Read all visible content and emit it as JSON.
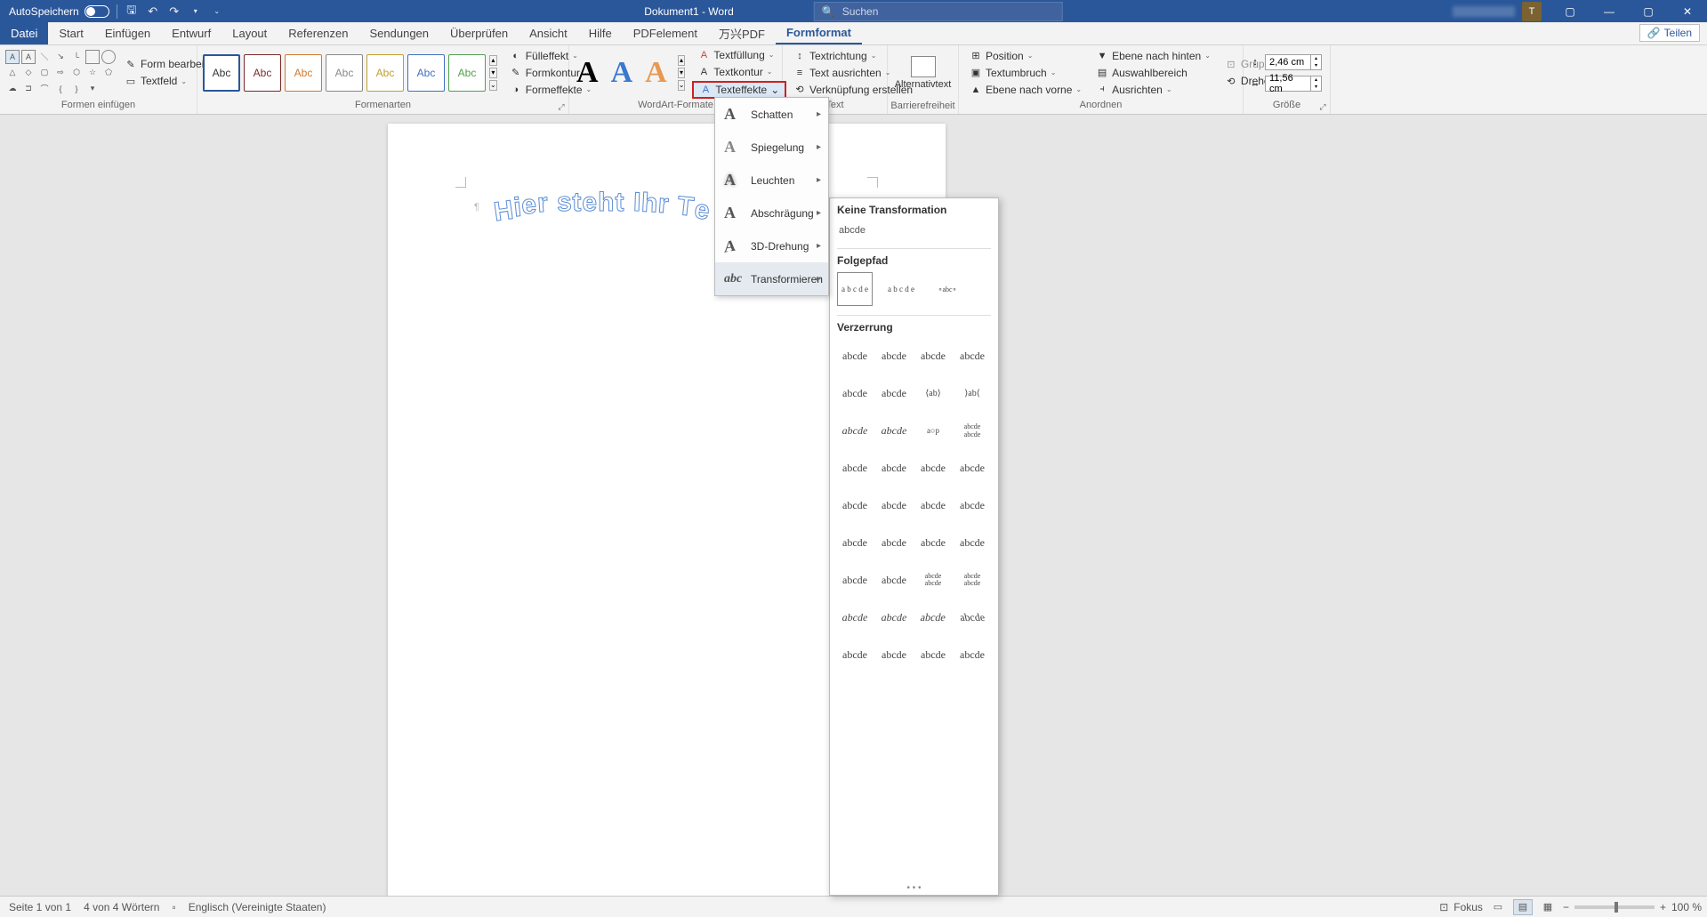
{
  "titlebar": {
    "autosave": "AutoSpeichern",
    "doc_title": "Dokument1 - Word",
    "search_placeholder": "Suchen",
    "avatar_initial": "T"
  },
  "tabs": {
    "file": "Datei",
    "items": [
      "Start",
      "Einfügen",
      "Entwurf",
      "Layout",
      "Referenzen",
      "Sendungen",
      "Überprüfen",
      "Ansicht",
      "Hilfe",
      "PDFelement",
      "万兴PDF",
      "Formformat"
    ],
    "active_index": 11,
    "share": "Teilen"
  },
  "ribbon": {
    "shapes": {
      "edit_shape": "Form bearbeiten",
      "textfield": "Textfeld",
      "group_label": "Formen einfügen"
    },
    "styles": {
      "label": "Abc",
      "fill": "Fülleffekt",
      "outline": "Formkontur",
      "effects": "Formeffekte",
      "group_label": "Formenarten"
    },
    "wordart": {
      "text_fill": "Textfüllung",
      "text_outline": "Textkontur",
      "text_effects": "Texteffekte",
      "group_label": "WordArt-Formate"
    },
    "text": {
      "direction": "Textrichtung",
      "align": "Text ausrichten",
      "link": "Verknüpfung erstellen",
      "group_label": "Text"
    },
    "accessibility": {
      "alt_text": "Alternativtext",
      "group_label": "Barrierefreiheit"
    },
    "arrange": {
      "position": "Position",
      "wrap": "Textumbruch",
      "forward": "Ebene nach vorne",
      "backward": "Ebene nach hinten",
      "selection_pane": "Auswahlbereich",
      "align": "Ausrichten",
      "group": "Gruppieren",
      "rotate": "Drehen",
      "group_label": "Anordnen"
    },
    "size": {
      "height": "2,46 cm",
      "width": "11,56 cm",
      "group_label": "Größe"
    }
  },
  "submenu": {
    "shadow": "Schatten",
    "reflection": "Spiegelung",
    "glow": "Leuchten",
    "bevel": "Abschrägung",
    "rotation3d": "3D-Drehung",
    "transform": "Transformieren"
  },
  "transform_panel": {
    "none_title": "Keine Transformation",
    "none_sample": "abcde",
    "path_title": "Folgepfad",
    "warp_title": "Verzerrung",
    "sample": "abcde"
  },
  "document": {
    "wordart_text": "Hier steht Ihr Te"
  },
  "statusbar": {
    "page": "Seite 1 von 1",
    "words": "4 von 4 Wörtern",
    "language": "Englisch (Vereinigte Staaten)",
    "focus": "Fokus",
    "zoom": "100 %"
  }
}
